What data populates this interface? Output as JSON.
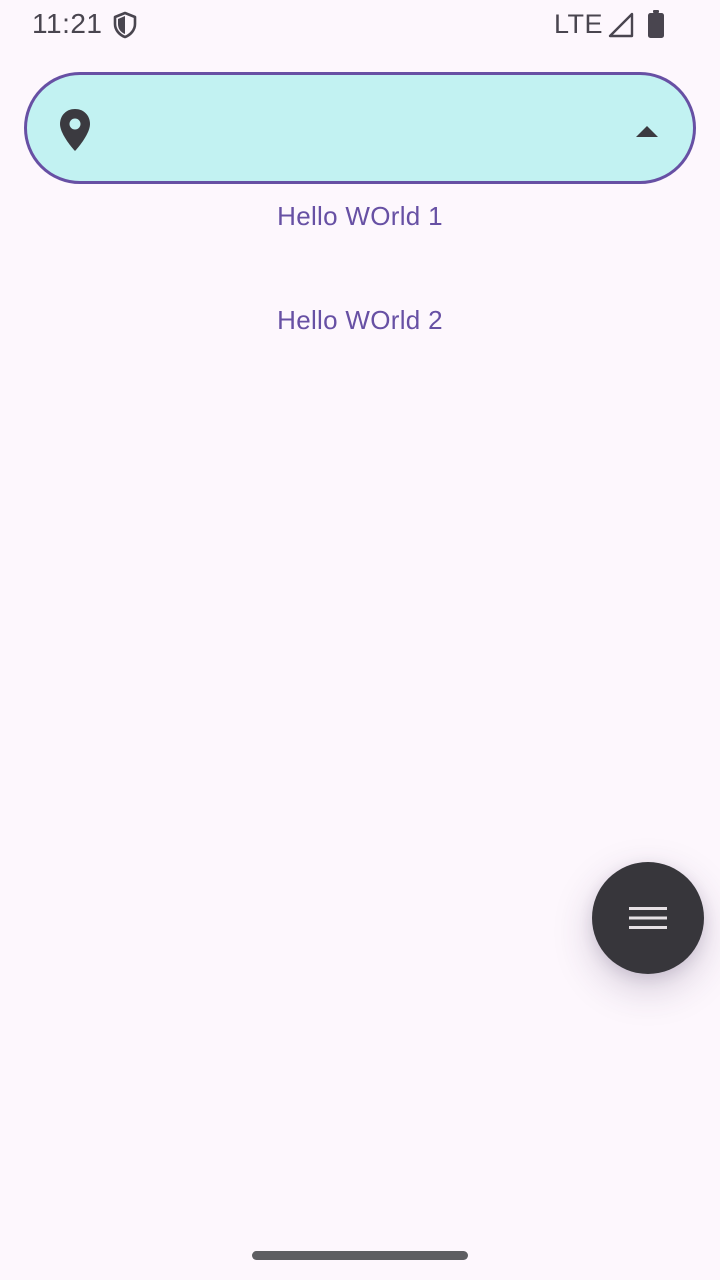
{
  "status_bar": {
    "time": "11:21",
    "network": "LTE",
    "icons": [
      "shield-icon",
      "signal-icon",
      "battery-icon"
    ]
  },
  "location_field": {
    "leading_icon": "location-pin-icon",
    "value": "",
    "trailing_icon": "arrow-up-icon",
    "colors": {
      "background": "#c2f2f2",
      "border": "#6750a4"
    }
  },
  "list": {
    "items": [
      {
        "label": "Hello WOrld 1"
      },
      {
        "label": "Hello WOrld 2"
      }
    ],
    "text_color": "#6750a4"
  },
  "fab": {
    "icon": "menu-icon",
    "color": "#37363b"
  },
  "colors": {
    "page_background": "#fdf7fd",
    "accent": "#6750a4"
  }
}
